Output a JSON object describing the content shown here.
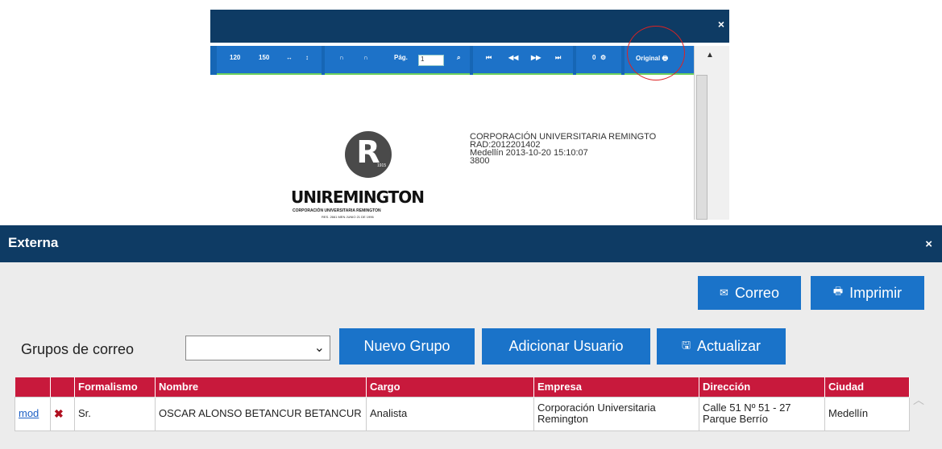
{
  "preview": {
    "close_icon": "×",
    "toolbar": {
      "zoom_120": "120",
      "zoom_150": "150",
      "pag_label": "Pág.",
      "pag_value": "1",
      "zero_label": "0",
      "original_label": "Original"
    },
    "document": {
      "logo_letter": "R",
      "logo_year": "1915",
      "logo_name": "UNIREMINGTON",
      "logo_sub": "CORPORACIÓN UNIVERSITARIA REMINGTON",
      "logo_sub2": "RES. 2661 MEN JUNIO 21 DE 1996",
      "rad_lines": [
        "CORPORACIÓN UNIVERSITARIA REMINGTO",
        "RAD:2012201402",
        "Medellín 2013-10-20 15:10:07",
        "3800"
      ]
    }
  },
  "window": {
    "title": "Externa",
    "close_icon": "×",
    "buttons": {
      "correo": "Correo",
      "imprimir": "Imprimir",
      "nuevo_grupo": "Nuevo Grupo",
      "adicionar_usuario": "Adicionar Usuario",
      "actualizar": "Actualizar"
    },
    "grupos_label": "Grupos de correo",
    "grupos_select_value": "",
    "table": {
      "headers": [
        "",
        "",
        "Formalismo",
        "Nombre",
        "Cargo",
        "Empresa",
        "Dirección",
        "Ciudad"
      ],
      "rows": [
        {
          "mod": "mod",
          "delete": "✖",
          "formalismo": "Sr.",
          "nombre": "OSCAR ALONSO BETANCUR BETANCUR",
          "cargo": "Analista",
          "empresa": "Corporación Universitaria Remington",
          "direccion": "Calle 51 Nº 51 - 27 Parque Berrío",
          "ciudad": "Medellín"
        }
      ]
    }
  },
  "colors": {
    "titlebar": "#0e3b64",
    "button": "#1a73c9",
    "table_header": "#c8193c",
    "highlight_circle": "#dd2222"
  }
}
